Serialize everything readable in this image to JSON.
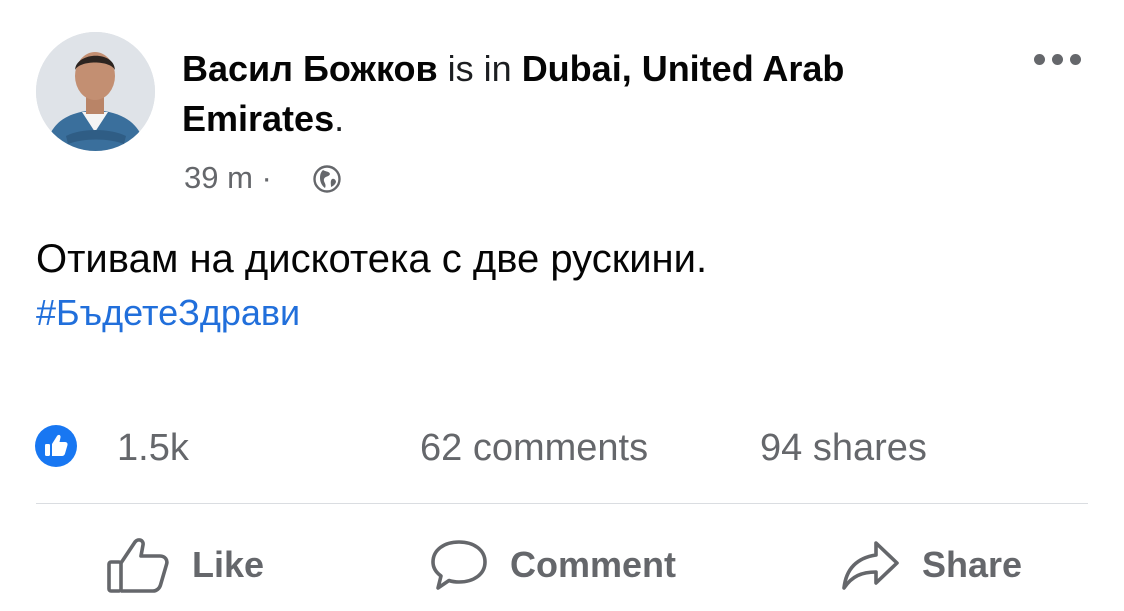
{
  "post": {
    "author": "Васил Божков",
    "connector": "is in",
    "location": "Dubai, United Arab Emirates",
    "location_line1": "Dubai, United Arab",
    "location_line2": "Emirates",
    "time": "39 m ·",
    "privacy_icon": "globe-icon",
    "text": "Отивам на дискотека с две рускини.",
    "hashtag": "#БъдетеЗдрави"
  },
  "stats": {
    "reactions": "1.5k",
    "comments": "62 comments",
    "shares": "94 shares"
  },
  "actions": {
    "like": "Like",
    "comment": "Comment",
    "share": "Share"
  },
  "colors": {
    "accent": "#1877f2",
    "hashtag": "#216fdb",
    "muted": "#65676b"
  }
}
